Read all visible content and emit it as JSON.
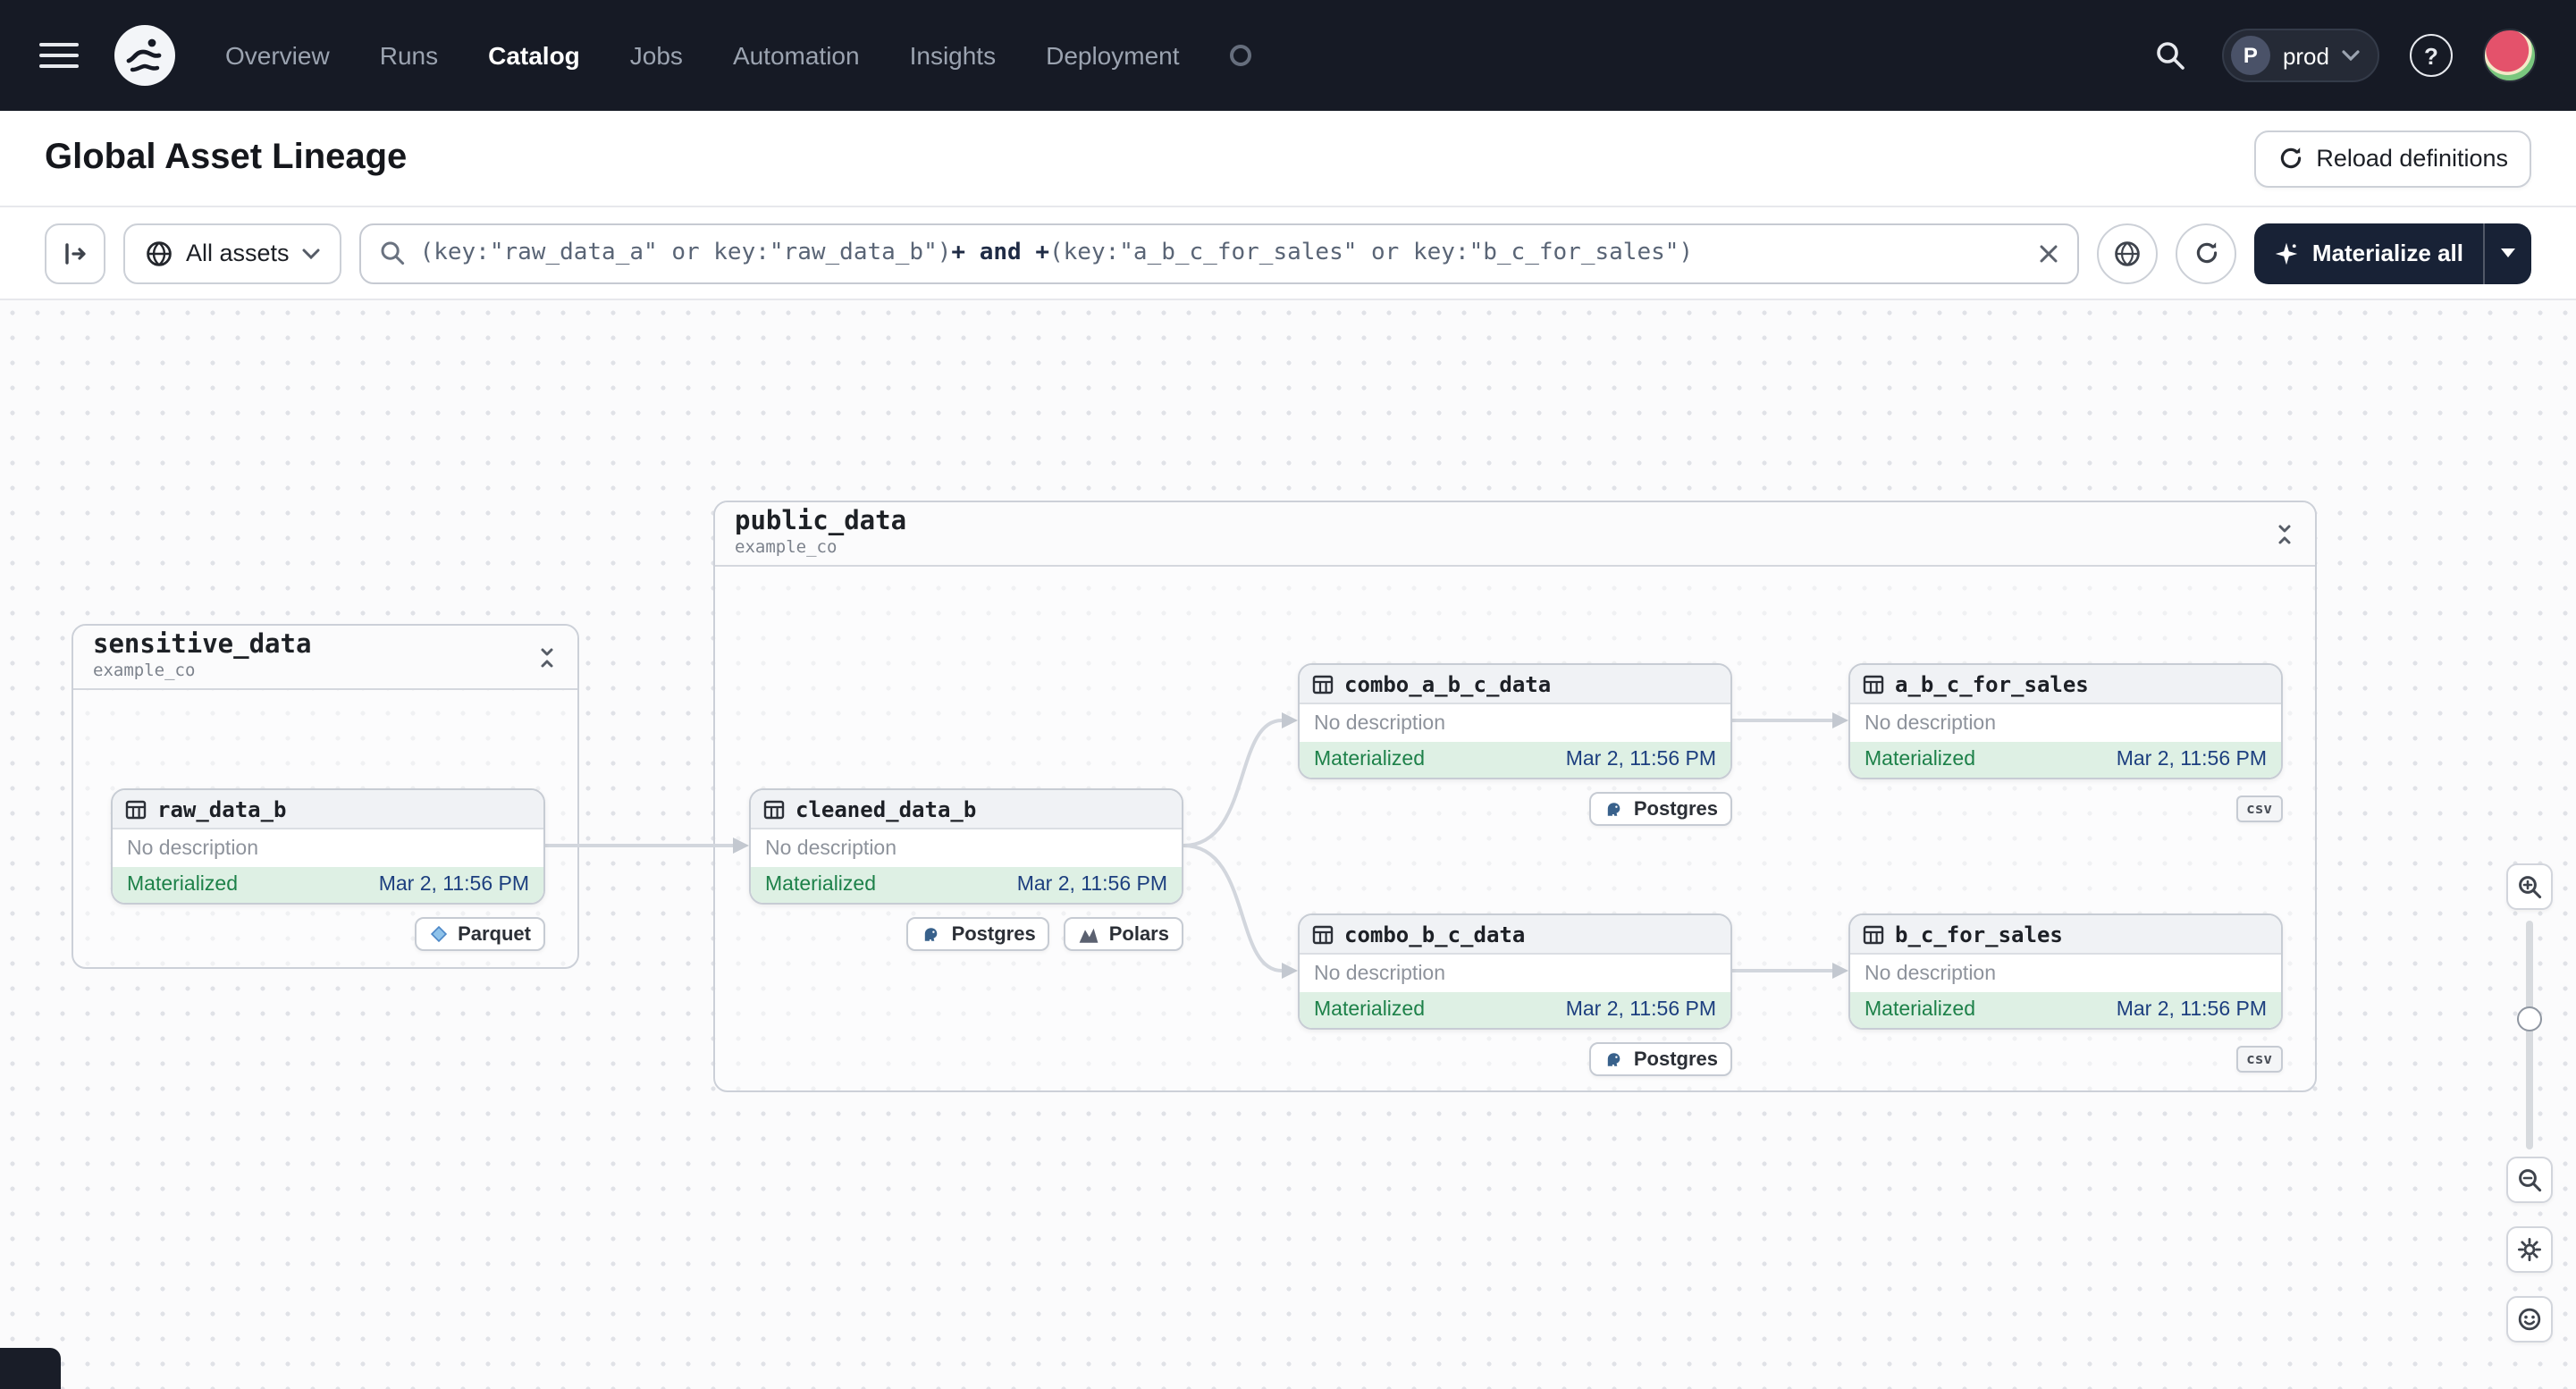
{
  "nav": {
    "menu_items": [
      {
        "label": "Overview",
        "active": false
      },
      {
        "label": "Runs",
        "active": false
      },
      {
        "label": "Catalog",
        "active": true
      },
      {
        "label": "Jobs",
        "active": false
      },
      {
        "label": "Automation",
        "active": false
      },
      {
        "label": "Insights",
        "active": false
      },
      {
        "label": "Deployment",
        "active": false
      }
    ],
    "prod_badge": {
      "initial": "P",
      "label": "prod"
    }
  },
  "icons": {
    "help_glyph": "?"
  },
  "header": {
    "title": "Global Asset Lineage",
    "reload_button_label": "Reload definitions"
  },
  "toolbar": {
    "scope_selector_label": "All assets",
    "query": {
      "part1": "(key:\"raw_data_a\" or key:\"raw_data_b\")",
      "operator": "+ and +",
      "part2": "(key:\"a_b_c_for_sales\" or key:\"b_c_for_sales\")"
    },
    "materialize_button_label": "Materialize all"
  },
  "graph": {
    "groups": [
      {
        "name": "sensitive_data",
        "location": "example_co"
      },
      {
        "name": "public_data",
        "location": "example_co"
      }
    ],
    "nodes": [
      {
        "name": "raw_data_b",
        "description": "No description",
        "status": "Materialized",
        "timestamp": "Mar 2, 11:56 PM",
        "tags": [
          "Parquet"
        ]
      },
      {
        "name": "cleaned_data_b",
        "description": "No description",
        "status": "Materialized",
        "timestamp": "Mar 2, 11:56 PM",
        "tags": [
          "Postgres",
          "Polars"
        ]
      },
      {
        "name": "combo_a_b_c_data",
        "description": "No description",
        "status": "Materialized",
        "timestamp": "Mar 2, 11:56 PM",
        "tags": [
          "Postgres"
        ]
      },
      {
        "name": "combo_b_c_data",
        "description": "No description",
        "status": "Materialized",
        "timestamp": "Mar 2, 11:56 PM",
        "tags": [
          "Postgres"
        ]
      },
      {
        "name": "a_b_c_for_sales",
        "description": "No description",
        "status": "Materialized",
        "timestamp": "Mar 2, 11:56 PM",
        "tags": [
          "csv"
        ]
      },
      {
        "name": "b_c_for_sales",
        "description": "No description",
        "status": "Materialized",
        "timestamp": "Mar 2, 11:56 PM",
        "tags": [
          "csv"
        ]
      }
    ]
  },
  "colors": {
    "nav_bg": "#161a25",
    "materialized_green": "#1d8149",
    "materialized_bg": "#def0e4",
    "timestamp_blue": "#1d3f7f",
    "postgres_blue": "#38618b"
  }
}
